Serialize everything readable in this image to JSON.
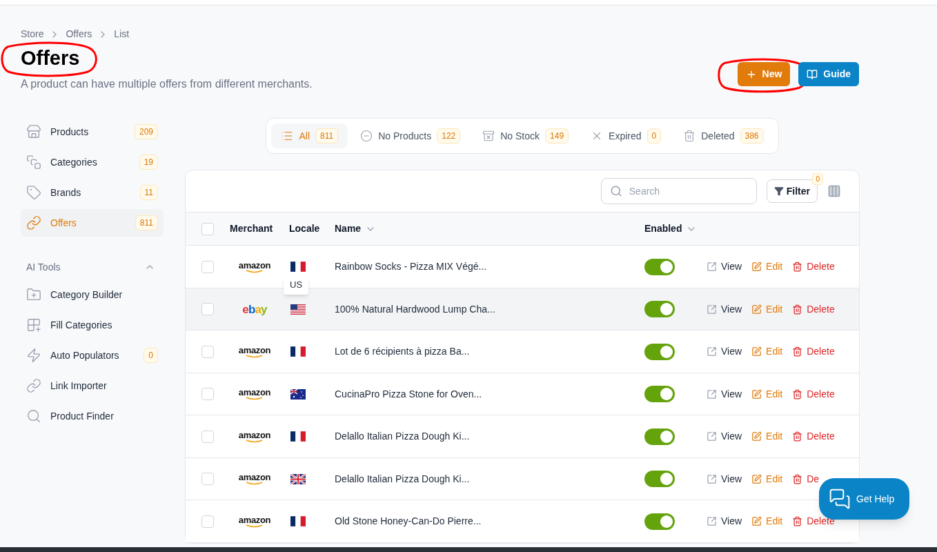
{
  "breadcrumb": [
    "Store",
    "Offers",
    "List"
  ],
  "page": {
    "title": "Offers",
    "title_circled": true,
    "subtitle": "A product can have multiple offers from different merchants."
  },
  "actions": [
    {
      "label": "New",
      "kind": "primary",
      "circled": true
    },
    {
      "label": "Guide",
      "kind": "secondary",
      "circled": false
    }
  ],
  "sidebar": {
    "items": [
      {
        "label": "Products",
        "count": "209",
        "selected": false
      },
      {
        "label": "Categories",
        "count": "19",
        "selected": false
      },
      {
        "label": "Brands",
        "count": "11",
        "selected": false
      },
      {
        "label": "Offers",
        "count": "811",
        "selected": true
      }
    ],
    "section": {
      "title": "AI Tools",
      "expanded": true,
      "items": [
        {
          "label": "Category Builder"
        },
        {
          "label": "Fill Categories"
        },
        {
          "label": "Auto Populators",
          "count": "0"
        },
        {
          "label": "Link Importer"
        },
        {
          "label": "Product Finder"
        }
      ]
    }
  },
  "status_tabs": [
    {
      "label": "All",
      "count": "811",
      "selected": true
    },
    {
      "label": "No Products",
      "count": "122",
      "selected": false
    },
    {
      "label": "No Stock",
      "count": "149",
      "selected": false
    },
    {
      "label": "Expired",
      "count": "0",
      "selected": false
    },
    {
      "label": "Deleted",
      "count": "386",
      "selected": false
    }
  ],
  "table": {
    "search": {
      "placeholder": "Search"
    },
    "filter": {
      "label": "Filter",
      "count": "0"
    },
    "select_all": {
      "checked": false
    },
    "columns": [
      {
        "label": "Merchant",
        "sortable": false
      },
      {
        "label": "Locale",
        "sortable": false
      },
      {
        "label": "Name",
        "sortable": true
      },
      {
        "label": "Enabled",
        "sortable": true
      }
    ],
    "rows": [
      {
        "checked": false,
        "hovered": false,
        "merchant": {
          "kind": "amazon",
          "text": "amazon"
        },
        "locale": {
          "kind": "fr"
        },
        "tooltip": "US",
        "name": "Rainbow Socks - Pizza MIX Végé...",
        "enabled": true,
        "actions": [
          "View",
          "Edit",
          "Delete"
        ]
      },
      {
        "checked": false,
        "hovered": true,
        "merchant": {
          "kind": "ebay",
          "text": "ebay"
        },
        "locale": {
          "kind": "us"
        },
        "name": "100% Natural Hardwood Lump Cha...",
        "enabled": true,
        "actions": [
          "View",
          "Edit",
          "Delete"
        ]
      },
      {
        "checked": false,
        "hovered": false,
        "merchant": {
          "kind": "amazon",
          "text": "amazon"
        },
        "locale": {
          "kind": "fr"
        },
        "name": "Lot de 6 récipients à pizza Ba...",
        "enabled": true,
        "actions": [
          "View",
          "Edit",
          "Delete"
        ]
      },
      {
        "checked": false,
        "hovered": false,
        "merchant": {
          "kind": "amazon",
          "text": "amazon"
        },
        "locale": {
          "kind": "au"
        },
        "name": "CucinaPro Pizza Stone for Oven...",
        "enabled": true,
        "actions": [
          "View",
          "Edit",
          "Delete"
        ]
      },
      {
        "checked": false,
        "hovered": false,
        "merchant": {
          "kind": "amazon",
          "text": "amazon"
        },
        "locale": {
          "kind": "fr"
        },
        "name": "Delallo Italian Pizza Dough Ki...",
        "enabled": true,
        "actions": [
          "View",
          "Edit",
          "Delete"
        ]
      },
      {
        "checked": false,
        "hovered": false,
        "merchant": {
          "kind": "amazon",
          "text": "amazon"
        },
        "locale": {
          "kind": "gb"
        },
        "name": "Delallo Italian Pizza Dough Ki...",
        "enabled": true,
        "actions": [
          "View",
          "Edit",
          "De"
        ]
      },
      {
        "checked": false,
        "hovered": false,
        "merchant": {
          "kind": "amazon",
          "text": "amazon"
        },
        "locale": {
          "kind": "fr"
        },
        "name": "Old Stone Honey-Can-Do Pierre...",
        "enabled": true,
        "actions": [
          "View",
          "Edit",
          "Delete"
        ]
      }
    ]
  },
  "help_button": {
    "label": "Get Help"
  }
}
